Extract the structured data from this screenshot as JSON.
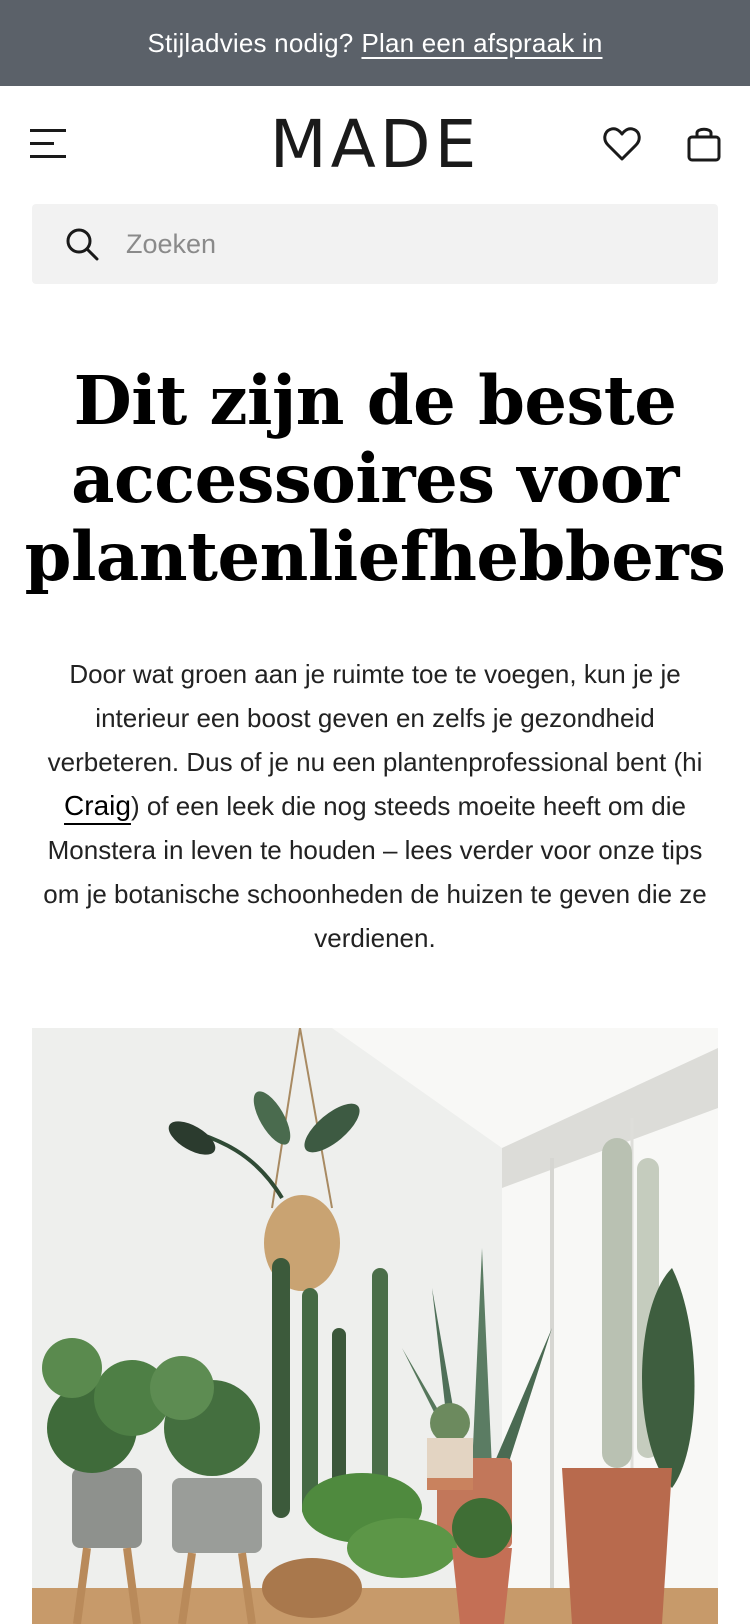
{
  "promo": {
    "text": "Stijladvies nodig?",
    "link": "Plan een afspraak in"
  },
  "header": {
    "logo": "MADE",
    "menu_icon": "hamburger-menu-icon",
    "wishlist_icon": "heart-icon",
    "bag_icon": "shopping-bag-icon"
  },
  "search": {
    "placeholder": "Zoeken",
    "value": ""
  },
  "article": {
    "title_line_1": "Dit zijn de beste",
    "title_line_2": "accessoires voor",
    "title_line_3": "plantenliefhebbers",
    "intro_before_link": "Door wat groen aan je ruimte toe te voegen, kun je je interieur een boost geven en zelfs je gezondheid verbeteren. Dus of je nu een plantenprofessional bent (hi ",
    "intro_link": "Craig",
    "intro_after_link": ") of een leek die nog steeds moeite heeft om die Monstera in leven te houden – lees verder voor onze tips om je botanische schoonheden de huizen te geven die ze verdienen."
  },
  "colors": {
    "promo_bg": "#5b6169",
    "search_bg": "#f2f2f2",
    "text": "#222222"
  }
}
